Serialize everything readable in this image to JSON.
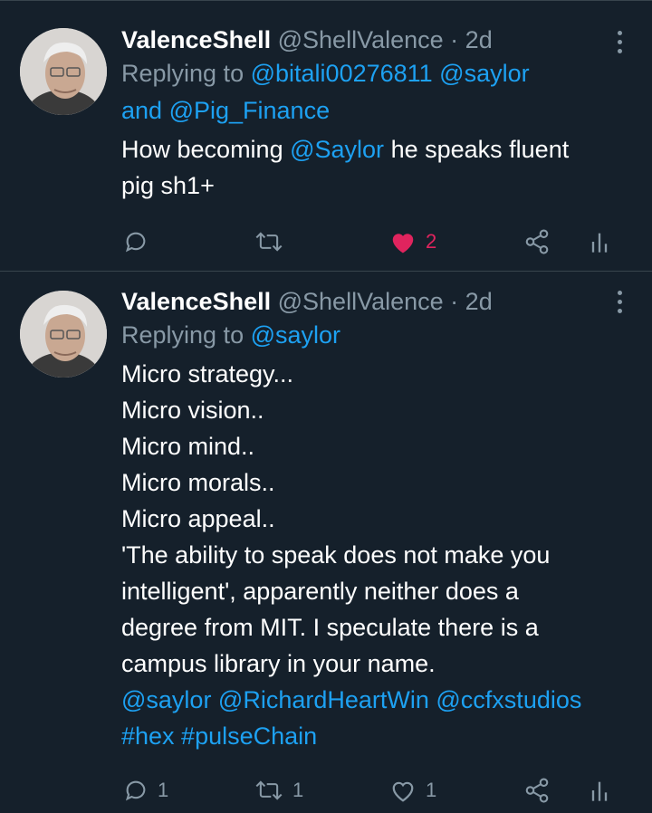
{
  "tweets": [
    {
      "name": "ValenceShell",
      "handle": "@ShellValence",
      "dot": "·",
      "time": "2d",
      "replying_prefix": "Replying to",
      "replying_mentions_1": "@bitali00276811 @saylor",
      "replying_and": "and",
      "replying_mentions_2": "@Pig_Finance",
      "text_before": "How becoming",
      "text_mention": "@Saylor",
      "text_after": "he speaks fluent",
      "text_line2": "pig sh1+",
      "reply_count": "",
      "retweet_count": "",
      "like_count": "2",
      "liked": true
    },
    {
      "name": "ValenceShell",
      "handle": "@ShellValence",
      "dot": "·",
      "time": "2d",
      "replying_prefix": "Replying to",
      "replying_mentions": "@saylor",
      "lines": [
        "Micro strategy...",
        "Micro vision..",
        "Micro mind..",
        "Micro morals..",
        "Micro appeal..",
        "'The ability to speak does not make you",
        "intelligent', apparently neither does a",
        "degree from MIT. I speculate there is a",
        "campus library in your name."
      ],
      "mention_line": "@saylor @RichardHeartWin @ccfxstudios",
      "hashtag_line": "#hex #pulseChain",
      "reply_count": "1",
      "retweet_count": "1",
      "like_count": "1",
      "liked": false
    }
  ],
  "icons": {
    "reply": "reply-bubble-icon",
    "retweet": "retweet-icon",
    "like": "heart-icon",
    "share": "share-icon",
    "analytics": "analytics-icon",
    "more": "more-vertical-icon"
  },
  "colors": {
    "background": "#15202b",
    "link": "#1da1f2",
    "muted": "#8899a6",
    "like": "#e0245e"
  }
}
